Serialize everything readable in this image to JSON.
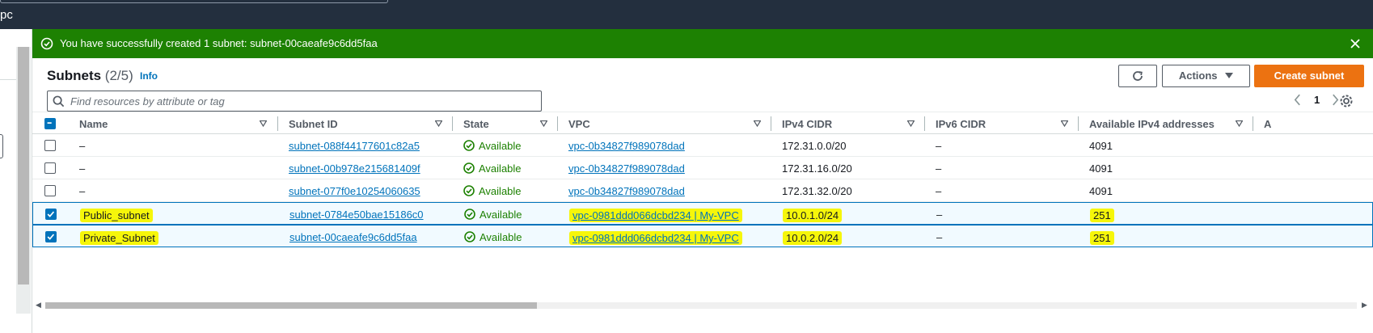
{
  "topbar": {
    "breadcrumb": "pc"
  },
  "flash": {
    "message": "You have successfully created 1 subnet: subnet-00caeafe9c6dd5faa"
  },
  "header": {
    "title": "Subnets",
    "count": "(2/5)",
    "info": "Info",
    "actions_label": "Actions",
    "create_label": "Create subnet"
  },
  "search": {
    "placeholder": "Find resources by attribute or tag"
  },
  "pager": {
    "page": "1"
  },
  "table": {
    "columns": [
      "Name",
      "Subnet ID",
      "State",
      "VPC",
      "IPv4 CIDR",
      "IPv6 CIDR",
      "Available IPv4 addresses",
      "A"
    ],
    "rows": [
      {
        "name": "–",
        "subnet_id": "subnet-088f44177601c82a5",
        "state": "Available",
        "vpc": "vpc-0b34827f989078dad",
        "ipv4": "172.31.0.0/20",
        "ipv6": "–",
        "available": "4091",
        "selected": false
      },
      {
        "name": "–",
        "subnet_id": "subnet-00b978e215681409f",
        "state": "Available",
        "vpc": "vpc-0b34827f989078dad",
        "ipv4": "172.31.16.0/20",
        "ipv6": "–",
        "available": "4091",
        "selected": false
      },
      {
        "name": "–",
        "subnet_id": "subnet-077f0e10254060635",
        "state": "Available",
        "vpc": "vpc-0b34827f989078dad",
        "ipv4": "172.31.32.0/20",
        "ipv6": "–",
        "available": "4091",
        "selected": false
      },
      {
        "name": "Public_subnet",
        "subnet_id": "subnet-0784e50bae15186c0",
        "state": "Available",
        "vpc": "vpc-0981ddd066dcbd234 | My-VPC",
        "ipv4": "10.0.1.0/24",
        "ipv6": "–",
        "available": "251",
        "selected": true
      },
      {
        "name": "Private_Subnet",
        "subnet_id": "subnet-00caeafe9c6dd5faa",
        "state": "Available",
        "vpc": "vpc-0981ddd066dcbd234 | My-VPC",
        "ipv4": "10.0.2.0/24",
        "ipv6": "–",
        "available": "251",
        "selected": true
      }
    ]
  },
  "colors": {
    "success": "#1d8102",
    "link": "#0073bb",
    "primary": "#ec7211",
    "highlight": "#f6f60a",
    "topbar": "#232f3e"
  }
}
